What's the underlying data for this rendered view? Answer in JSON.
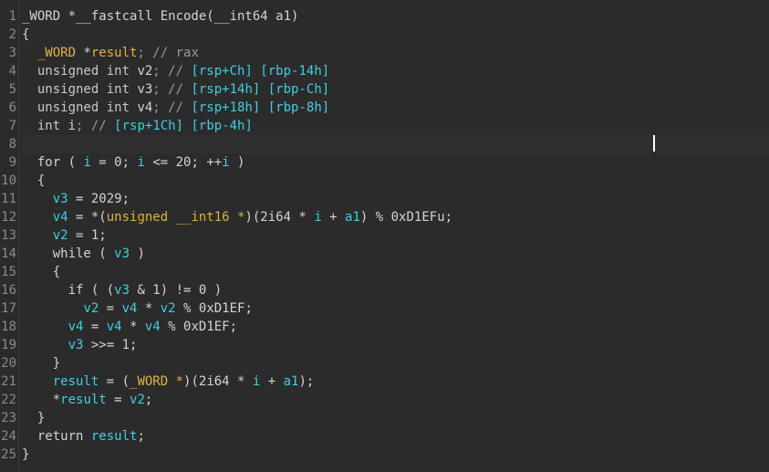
{
  "editor": {
    "current_line": 8,
    "lines": [
      {
        "n": "1",
        "tokens": [
          {
            "t": "_WORD *__fastcall Encode(__int64 a1)",
            "c": "plain"
          }
        ]
      },
      {
        "n": "2",
        "tokens": [
          {
            "t": "{",
            "c": "plain"
          }
        ]
      },
      {
        "n": "3",
        "tokens": [
          {
            "t": "  ",
            "c": "plain"
          },
          {
            "t": "_WORD",
            "c": "orange"
          },
          {
            "t": " *",
            "c": "plain"
          },
          {
            "t": "result",
            "c": "orange"
          },
          {
            "t": "; // rax",
            "c": "comment"
          }
        ]
      },
      {
        "n": "4",
        "tokens": [
          {
            "t": "  unsigned int ",
            "c": "type"
          },
          {
            "t": "v2",
            "c": "plain"
          },
          {
            "t": "; // ",
            "c": "comment"
          },
          {
            "t": "[rsp+Ch] [rbp-14h]",
            "c": "reg"
          }
        ]
      },
      {
        "n": "5",
        "tokens": [
          {
            "t": "  unsigned int ",
            "c": "type"
          },
          {
            "t": "v3",
            "c": "plain"
          },
          {
            "t": "; // ",
            "c": "comment"
          },
          {
            "t": "[rsp+14h] [rbp-Ch]",
            "c": "reg"
          }
        ]
      },
      {
        "n": "6",
        "tokens": [
          {
            "t": "  unsigned int ",
            "c": "type"
          },
          {
            "t": "v4",
            "c": "plain"
          },
          {
            "t": "; // ",
            "c": "comment"
          },
          {
            "t": "[rsp+18h] [rbp-8h]",
            "c": "reg"
          }
        ]
      },
      {
        "n": "7",
        "tokens": [
          {
            "t": "  int ",
            "c": "type"
          },
          {
            "t": "i",
            "c": "plain"
          },
          {
            "t": "; // ",
            "c": "comment"
          },
          {
            "t": "[rsp+1Ch] [rbp-4h]",
            "c": "reg"
          }
        ]
      },
      {
        "n": "8",
        "tokens": [
          {
            "t": "",
            "c": "plain"
          }
        ]
      },
      {
        "n": "9",
        "tokens": [
          {
            "t": "  for ( ",
            "c": "kw"
          },
          {
            "t": "i",
            "c": "var"
          },
          {
            "t": " = 0; ",
            "c": "plain"
          },
          {
            "t": "i",
            "c": "var"
          },
          {
            "t": " <= 20; ++",
            "c": "plain"
          },
          {
            "t": "i",
            "c": "var"
          },
          {
            "t": " )",
            "c": "plain"
          }
        ]
      },
      {
        "n": "10",
        "tokens": [
          {
            "t": "  {",
            "c": "plain"
          }
        ]
      },
      {
        "n": "11",
        "tokens": [
          {
            "t": "    ",
            "c": "plain"
          },
          {
            "t": "v3",
            "c": "var"
          },
          {
            "t": " = 2029;",
            "c": "plain"
          }
        ]
      },
      {
        "n": "12",
        "tokens": [
          {
            "t": "    ",
            "c": "plain"
          },
          {
            "t": "v4",
            "c": "var"
          },
          {
            "t": " = *(",
            "c": "plain"
          },
          {
            "t": "unsigned __int16 *",
            "c": "cast"
          },
          {
            "t": ")(2i64 * ",
            "c": "plain"
          },
          {
            "t": "i",
            "c": "var"
          },
          {
            "t": " + ",
            "c": "plain"
          },
          {
            "t": "a1",
            "c": "var"
          },
          {
            "t": ") % 0xD1EFu;",
            "c": "plain"
          }
        ]
      },
      {
        "n": "13",
        "tokens": [
          {
            "t": "    ",
            "c": "plain"
          },
          {
            "t": "v2",
            "c": "var"
          },
          {
            "t": " = 1;",
            "c": "plain"
          }
        ]
      },
      {
        "n": "14",
        "tokens": [
          {
            "t": "    while ( ",
            "c": "kw"
          },
          {
            "t": "v3",
            "c": "var"
          },
          {
            "t": " )",
            "c": "plain"
          }
        ]
      },
      {
        "n": "15",
        "tokens": [
          {
            "t": "    {",
            "c": "plain"
          }
        ]
      },
      {
        "n": "16",
        "tokens": [
          {
            "t": "      if ( (",
            "c": "kw"
          },
          {
            "t": "v3",
            "c": "var"
          },
          {
            "t": " & 1) != 0 )",
            "c": "plain"
          }
        ]
      },
      {
        "n": "17",
        "tokens": [
          {
            "t": "        ",
            "c": "plain"
          },
          {
            "t": "v2",
            "c": "var"
          },
          {
            "t": " = ",
            "c": "plain"
          },
          {
            "t": "v4",
            "c": "var"
          },
          {
            "t": " * ",
            "c": "plain"
          },
          {
            "t": "v2",
            "c": "var"
          },
          {
            "t": " % 0xD1EF;",
            "c": "plain"
          }
        ]
      },
      {
        "n": "18",
        "tokens": [
          {
            "t": "      ",
            "c": "plain"
          },
          {
            "t": "v4",
            "c": "var"
          },
          {
            "t": " = ",
            "c": "plain"
          },
          {
            "t": "v4",
            "c": "var"
          },
          {
            "t": " * ",
            "c": "plain"
          },
          {
            "t": "v4",
            "c": "var"
          },
          {
            "t": " % 0xD1EF;",
            "c": "plain"
          }
        ]
      },
      {
        "n": "19",
        "tokens": [
          {
            "t": "      ",
            "c": "plain"
          },
          {
            "t": "v3",
            "c": "var"
          },
          {
            "t": " >>= 1;",
            "c": "plain"
          }
        ]
      },
      {
        "n": "20",
        "tokens": [
          {
            "t": "    }",
            "c": "plain"
          }
        ]
      },
      {
        "n": "21",
        "tokens": [
          {
            "t": "    ",
            "c": "plain"
          },
          {
            "t": "result",
            "c": "var"
          },
          {
            "t": " = (",
            "c": "plain"
          },
          {
            "t": "_WORD *",
            "c": "cast"
          },
          {
            "t": ")(2i64 * ",
            "c": "plain"
          },
          {
            "t": "i",
            "c": "var"
          },
          {
            "t": " + ",
            "c": "plain"
          },
          {
            "t": "a1",
            "c": "var"
          },
          {
            "t": ");",
            "c": "plain"
          }
        ]
      },
      {
        "n": "22",
        "tokens": [
          {
            "t": "    *",
            "c": "plain"
          },
          {
            "t": "result",
            "c": "var"
          },
          {
            "t": " = ",
            "c": "plain"
          },
          {
            "t": "v2",
            "c": "var"
          },
          {
            "t": ";",
            "c": "plain"
          }
        ]
      },
      {
        "n": "23",
        "tokens": [
          {
            "t": "  }",
            "c": "plain"
          }
        ]
      },
      {
        "n": "24",
        "tokens": [
          {
            "t": "  return ",
            "c": "kw"
          },
          {
            "t": "result",
            "c": "var"
          },
          {
            "t": ";",
            "c": "plain"
          }
        ]
      },
      {
        "n": "25",
        "tokens": [
          {
            "t": "}",
            "c": "plain"
          }
        ]
      }
    ]
  }
}
